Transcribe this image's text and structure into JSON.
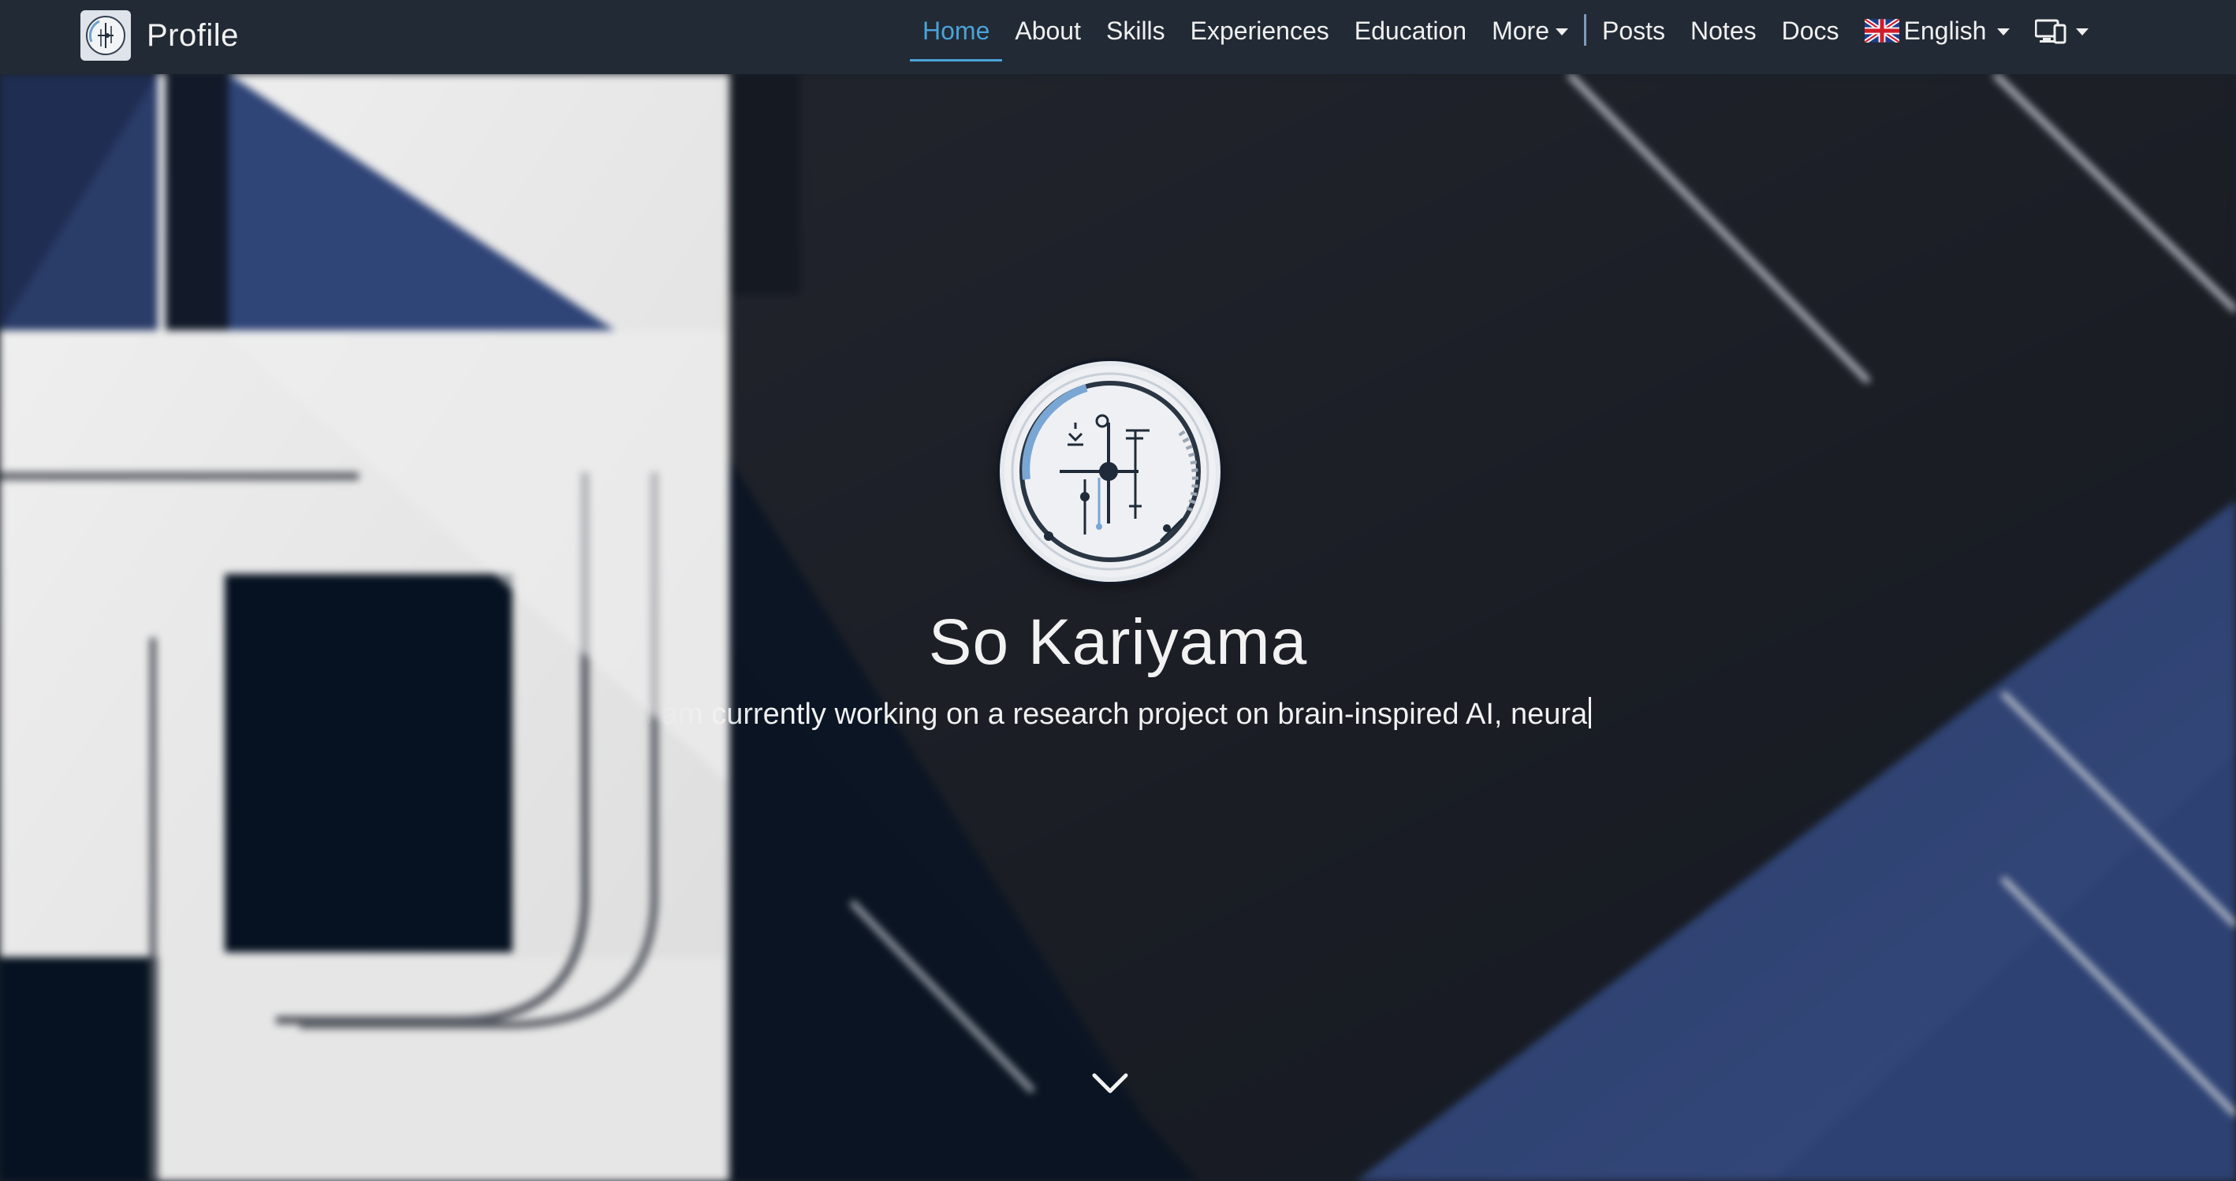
{
  "navbar": {
    "brand_title": "Profile",
    "brand_logo_icon": "circuit-logo-icon",
    "links": [
      {
        "label": "Home",
        "active": true
      },
      {
        "label": "About",
        "active": false
      },
      {
        "label": "Skills",
        "active": false
      },
      {
        "label": "Experiences",
        "active": false
      },
      {
        "label": "Education",
        "active": false
      },
      {
        "label": "More",
        "active": false,
        "dropdown": true
      }
    ],
    "secondary_links": [
      {
        "label": "Posts"
      },
      {
        "label": "Notes"
      },
      {
        "label": "Docs"
      }
    ],
    "language": {
      "label": "English",
      "icon": "uk-flag-icon",
      "dropdown": true
    },
    "theme": {
      "icon": "monitor-icon",
      "dropdown": true
    },
    "accent_color": "#4aa3d8",
    "background_color": "#222a35"
  },
  "hero": {
    "name": "So Kariyama",
    "subtitle": "I am currently working on a research project on brain-inspired AI, neura",
    "avatar_icon": "circuit-avatar-icon",
    "scroll_icon": "chevron-down-icon"
  }
}
